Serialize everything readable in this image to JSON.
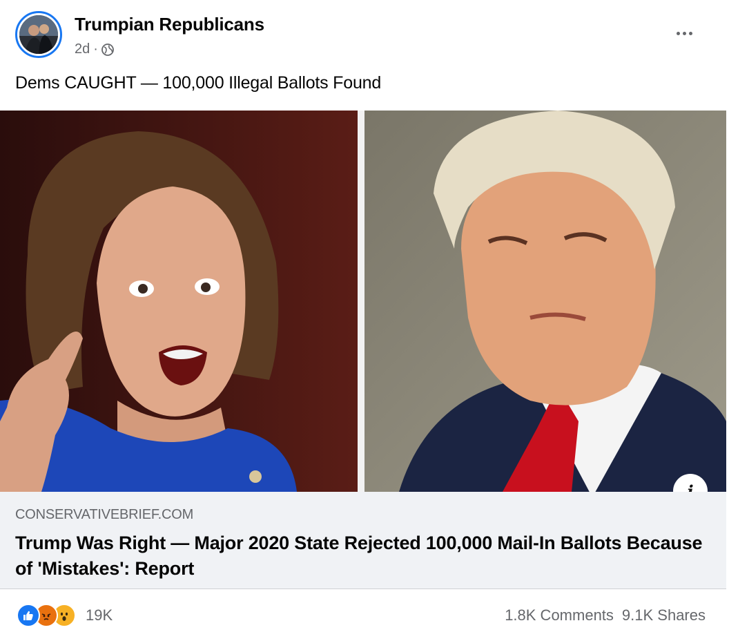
{
  "post": {
    "page_name": "Trumpian Republicans",
    "time": "2d",
    "separator": "·",
    "caption": "Dems CAUGHT — 100,000 Illegal Ballots Found"
  },
  "icons": {
    "audience": "globe-icon",
    "menu": "more-options-icon",
    "info": "info-icon",
    "reactions": [
      "like-icon",
      "angry-icon",
      "wow-icon"
    ]
  },
  "media": {
    "info_glyph": "i"
  },
  "link_preview": {
    "domain": "CONSERVATIVEBRIEF.COM",
    "headline": "Trump Was Right — Major 2020 State Rejected 100,000 Mail-In Ballots Because of 'Mistakes': Report"
  },
  "engagement": {
    "reaction_count": "19K",
    "comments": "1.8K Comments",
    "shares": "9.1K Shares"
  },
  "colors": {
    "brand_blue": "#1877f2",
    "secondary_text": "#65676b",
    "preview_bg": "#f0f2f5"
  }
}
